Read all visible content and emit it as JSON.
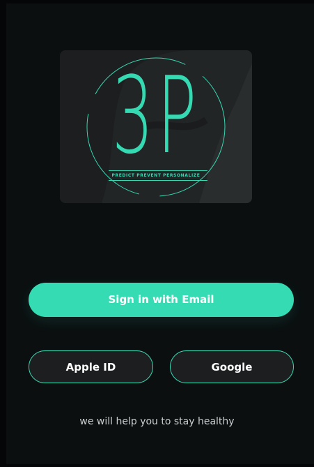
{
  "logo": {
    "mark": "3P",
    "tagline": "PREDICT PREVENT PERSONALIZE"
  },
  "buttons": {
    "email": "Sign in with Email",
    "apple": "Apple ID",
    "google": "Google"
  },
  "footer_text": "we will help you to stay healthy",
  "colors": {
    "background": "#0b0f10",
    "accent": "#35dcb3",
    "button_dark": "#1c1e1f",
    "text": "#ffffff"
  }
}
